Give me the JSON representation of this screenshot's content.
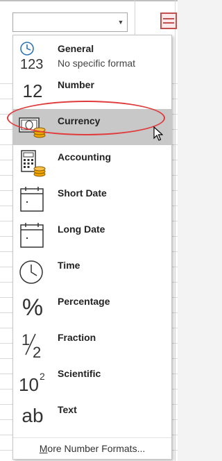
{
  "number_format_box": {
    "value": ""
  },
  "menu": {
    "items": [
      {
        "title": "General",
        "description": "No specific format",
        "icon": "clock-123-icon",
        "glyph": "123"
      },
      {
        "title": "Number",
        "description": "",
        "icon": "number-12-icon",
        "glyph": "12"
      },
      {
        "title": "Currency",
        "description": "",
        "icon": "currency-icon",
        "selected": true
      },
      {
        "title": "Accounting",
        "description": "",
        "icon": "accounting-calculator-icon"
      },
      {
        "title": "Short Date",
        "description": "",
        "icon": "short-date-calendar-icon"
      },
      {
        "title": "Long Date",
        "description": "",
        "icon": "long-date-calendar-icon"
      },
      {
        "title": "Time",
        "description": "",
        "icon": "clock-icon"
      },
      {
        "title": "Percentage",
        "description": "",
        "icon": "percent-icon",
        "glyph": "%"
      },
      {
        "title": "Fraction",
        "description": "",
        "icon": "fraction-icon",
        "glyph_num": "1",
        "glyph_den": "2"
      },
      {
        "title": "Scientific",
        "description": "",
        "icon": "scientific-icon",
        "glyph_base": "10",
        "glyph_exp": "2"
      },
      {
        "title": "Text",
        "description": "",
        "icon": "text-ab-icon",
        "glyph": "ab"
      }
    ],
    "more_prefix": "M",
    "more_rest": "ore Number Formats..."
  },
  "colors": {
    "highlight": "#e03a3a",
    "selection": "#c8c8c8",
    "coin": "#f0a500",
    "accent_blue": "#2e75b6"
  }
}
